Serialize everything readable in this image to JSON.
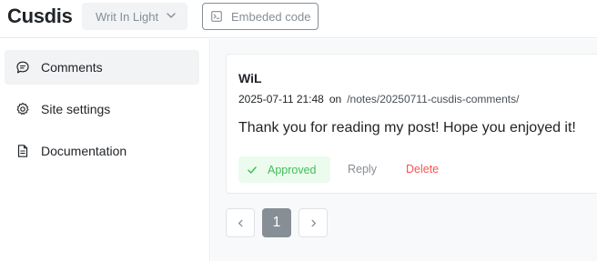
{
  "header": {
    "logo": "Cusdis",
    "site_select": "Writ In Light",
    "embed_button": "Embeded code"
  },
  "sidebar": {
    "items": [
      {
        "label": "Comments",
        "icon": "comment-icon",
        "active": true
      },
      {
        "label": "Site settings",
        "icon": "settings-icon",
        "active": false
      },
      {
        "label": "Documentation",
        "icon": "document-icon",
        "active": false
      }
    ]
  },
  "comment": {
    "author": "WiL",
    "date": "2025-07-11 21:48",
    "on_label": "on",
    "page": "/notes/20250711-cusdis-comments/",
    "content": "Thank you for reading my post! Hope you enjoyed it!",
    "status_label": "Approved",
    "reply_label": "Reply",
    "delete_label": "Delete"
  },
  "pagination": {
    "current_page": "1",
    "prev_icon": "chevron-left-icon",
    "next_icon": "chevron-right-icon"
  },
  "colors": {
    "approved_text": "#40c057",
    "approved_bg": "#ebfbee",
    "delete_text": "#fa5252",
    "active_page_bg": "#868e96"
  }
}
